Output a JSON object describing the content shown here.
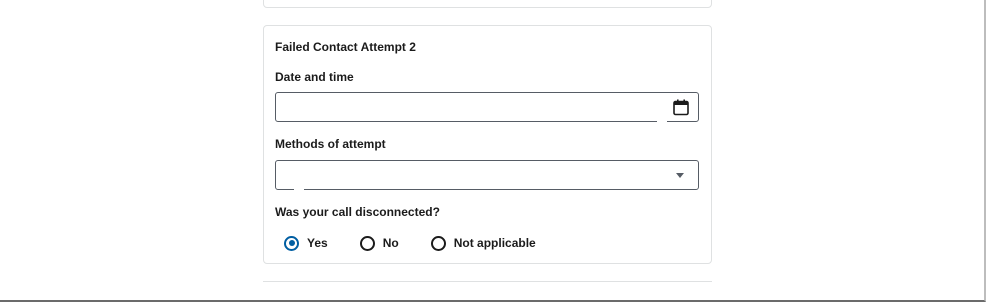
{
  "attempt_card": {
    "title": "Failed Contact Attempt 2",
    "date_field": {
      "label": "Date and time",
      "value": ""
    },
    "methods_field": {
      "label": "Methods of attempt",
      "selected": ""
    },
    "disconnected_question": {
      "label": "Was your call disconnected?",
      "options": [
        "Yes",
        "No",
        "Not applicable"
      ],
      "selected": "Yes"
    }
  },
  "colors": {
    "accent": "#005ea2",
    "border": "#dfe1e2",
    "input_border": "#565c65",
    "text": "#1b1b1b"
  },
  "icons": {
    "date_picker": "calendar-icon",
    "select": "chevron-down-icon"
  }
}
